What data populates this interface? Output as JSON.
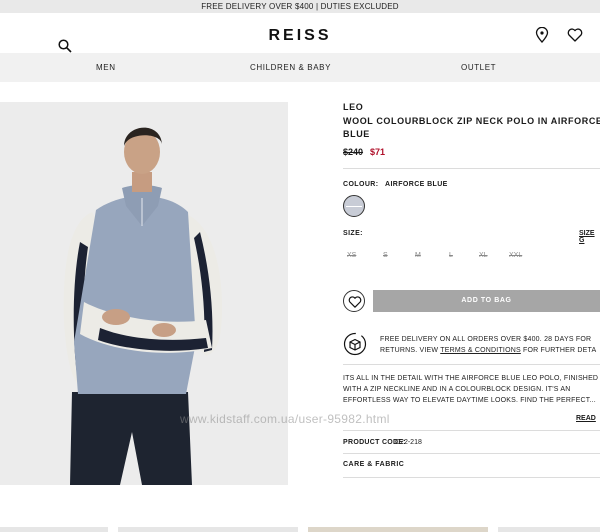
{
  "promo": {
    "text": "FREE DELIVERY OVER $400 | DUTIES EXCLUDED"
  },
  "header": {
    "logo": "REISS",
    "icons": {
      "search": "search-icon",
      "store": "map-pin-icon",
      "wishlist": "heart-icon"
    }
  },
  "nav": {
    "items": [
      "MEN",
      "CHILDREN & BABY",
      "OUTLET"
    ]
  },
  "product": {
    "brand": "LEO",
    "title": "WOOL COLOURBLOCK ZIP NECK POLO IN AIRFORCE BLUE",
    "price_old": "$240",
    "price_new": "$71",
    "colour_label": "COLOUR:",
    "colour_value": "AIRFORCE BLUE",
    "size_label": "SIZE:",
    "size_guide": "SIZE G",
    "sizes": [
      "XS",
      "S",
      "M",
      "L",
      "XL",
      "XXL"
    ],
    "add_to_bag": "ADD TO BAG",
    "delivery_pre": "FREE DELIVERY ON ALL ORDERS OVER $400. 28 DAYS FOR RETURNS. VIEW ",
    "delivery_link": "TERMS & CONDITIONS",
    "delivery_post": " FOR FURTHER DETA",
    "description": "ITS ALL IN THE DETAIL WITH THE AIRFORCE BLUE LEO POLO, FINISHED WITH A ZIP NECKLINE AND IN A COLOURBLOCK DESIGN. IT'S AN EFFORTLESS WAY TO ELEVATE DAYTIME LOOKS. FIND THE PERFECT...",
    "read_more": "READ",
    "code_label": "PRODUCT CODE:",
    "code_value": "C22-218",
    "care_label": "CARE & FABRIC"
  },
  "watermark": "www.kidstaff.com.ua/user-95982.html",
  "colors": {
    "accent_price": "#b0102a",
    "bag_button": "#a6a6a6",
    "nav_bg": "#f1f1f1",
    "promo_bg": "#e9e9e9"
  }
}
